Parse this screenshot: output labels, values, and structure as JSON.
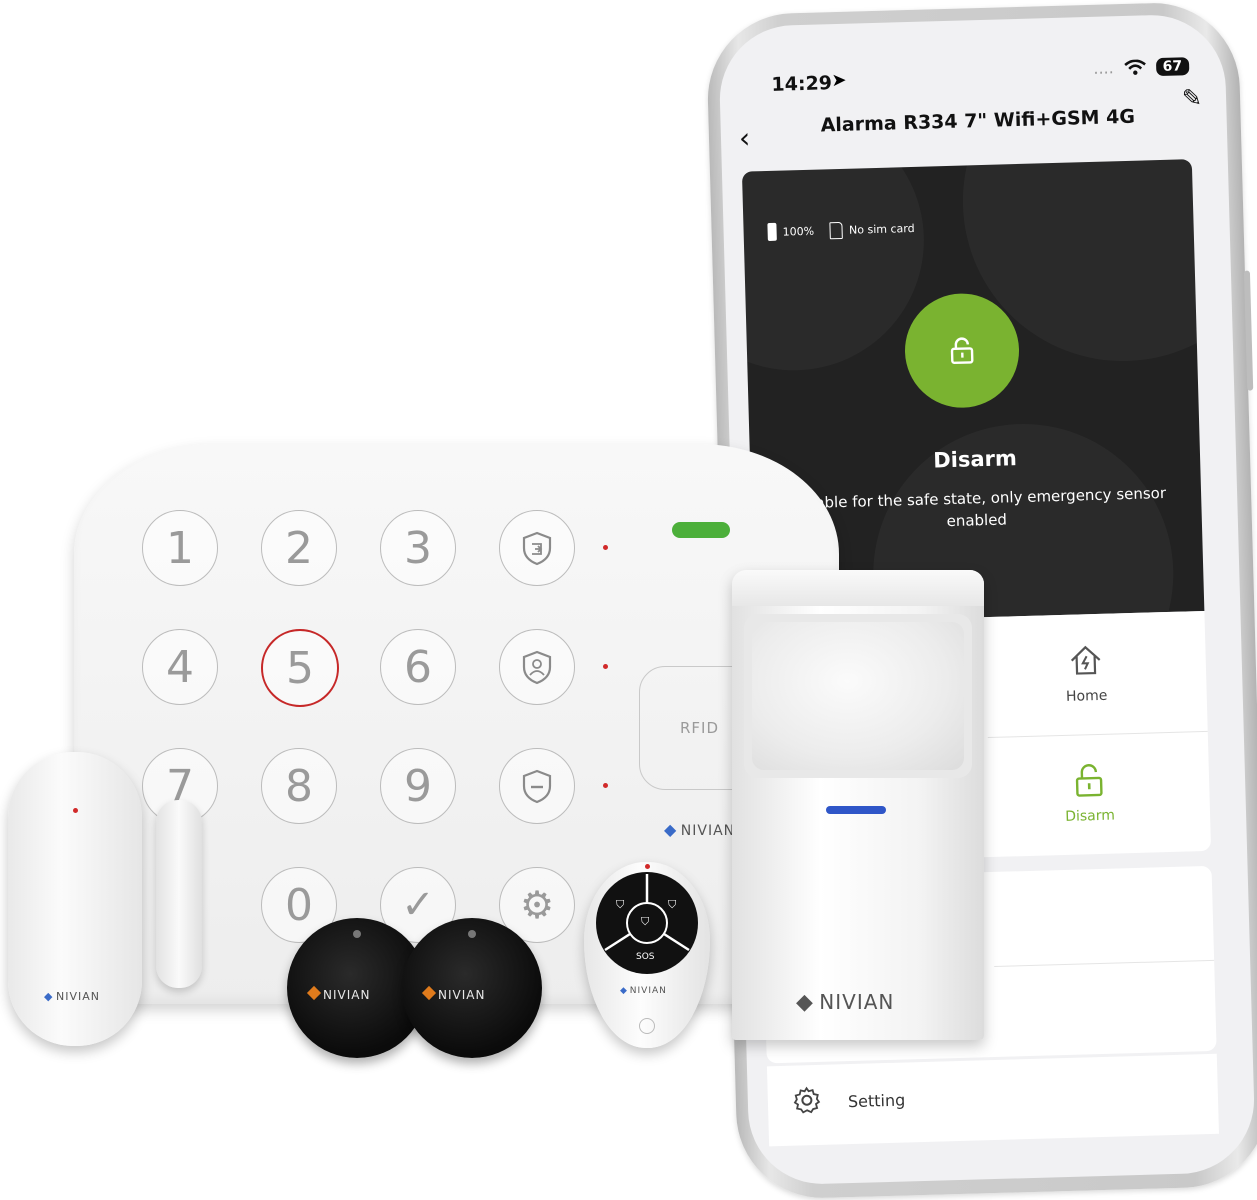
{
  "phone": {
    "status_time": "14:29",
    "status_signal": "....",
    "status_battery": "67",
    "nav_title": "Alarma R334 7\" Wifi+GSM 4G",
    "battery_percent": "100%",
    "sim_status": "No sim card",
    "state_title": "Disarm",
    "state_description": "Suitable for the safe state, only emergency sensor enabled",
    "modes": [
      {
        "label": "Home",
        "icon": "home-shield-icon"
      },
      {
        "label": "Disarm",
        "icon": "unlock-icon",
        "active": true
      }
    ],
    "setting_label": "Setting",
    "accent_color": "#7ab330"
  },
  "hub": {
    "keys": [
      "1",
      "2",
      "3",
      "4",
      "5",
      "6",
      "7",
      "8",
      "9",
      "0"
    ],
    "function_icons": [
      "arm-shield-icon",
      "home-shield-icon",
      "disarm-shield-icon",
      "check-icon",
      "gear-icon"
    ],
    "rfid_label": "RFID",
    "brand": "NIVIAN"
  },
  "accessories": {
    "door_sensor_brand": "NIVIAN",
    "tag_brand": "NIVIAN",
    "remote_sos_label": "SOS",
    "remote_brand": "NIVIAN",
    "pir_brand": "NIVIAN"
  }
}
